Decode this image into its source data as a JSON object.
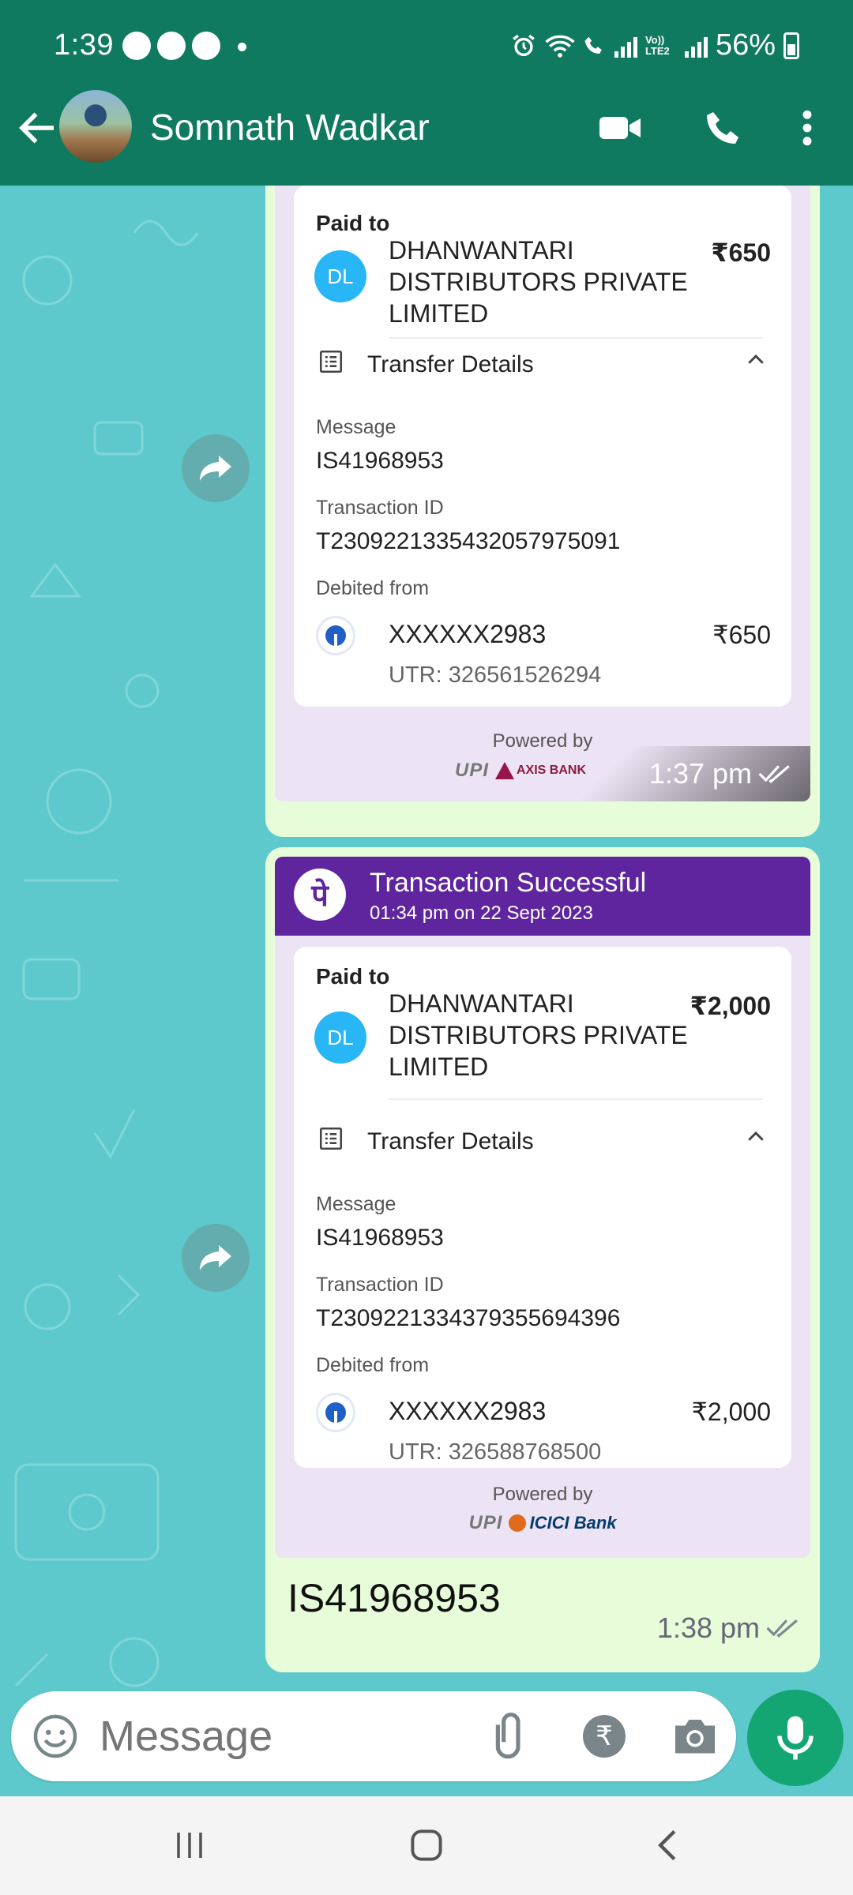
{
  "status_bar": {
    "time": "1:39",
    "lte_label": "Vo)) LTE2",
    "battery": "56%",
    "battery_level": 0.56
  },
  "header": {
    "contact_name": "Somnath Wadkar"
  },
  "messages": [
    {
      "paid_to_label": "Paid to",
      "payee_initials": "DL",
      "payee": "DHANWANTARI DISTRIBUTORS PRIVATE LIMITED",
      "amount": "₹650",
      "transfer_details_label": "Transfer Details",
      "message_label": "Message",
      "message_value": "IS41968953",
      "txn_label": "Transaction ID",
      "txn_value": "T2309221335432057975091",
      "debited_label": "Debited from",
      "account": "XXXXXX2983",
      "debited_amount": "₹650",
      "utr": "UTR: 326561526294",
      "powered_by": "Powered by",
      "upi_text": "UPI",
      "bank": "AXIS BANK",
      "time": "1:37 pm"
    },
    {
      "header_title": "Transaction Successful",
      "header_sub": "01:34 pm on 22 Sept 2023",
      "logo_glyph": "पे",
      "paid_to_label": "Paid to",
      "payee_initials": "DL",
      "payee": "DHANWANTARI DISTRIBUTORS PRIVATE LIMITED",
      "amount": "₹2,000",
      "transfer_details_label": "Transfer Details",
      "message_label": "Message",
      "message_value": "IS41968953",
      "txn_label": "Transaction ID",
      "txn_value": "T2309221334379355694396",
      "debited_label": "Debited from",
      "account": "XXXXXX2983",
      "debited_amount": "₹2,000",
      "utr": "UTR: 326588768500",
      "powered_by": "Powered by",
      "upi_text": "UPI",
      "bank": "ICICI Bank",
      "caption": "IS41968953",
      "time": "1:38 pm"
    }
  ],
  "input": {
    "placeholder": "Message",
    "rupee_glyph": "₹"
  },
  "colors": {
    "header": "#0f7a5f",
    "wallpaper": "#5ec9cc",
    "phonepe": "#5f259f",
    "bubble": "#e7fcd9",
    "mic": "#14a672"
  }
}
